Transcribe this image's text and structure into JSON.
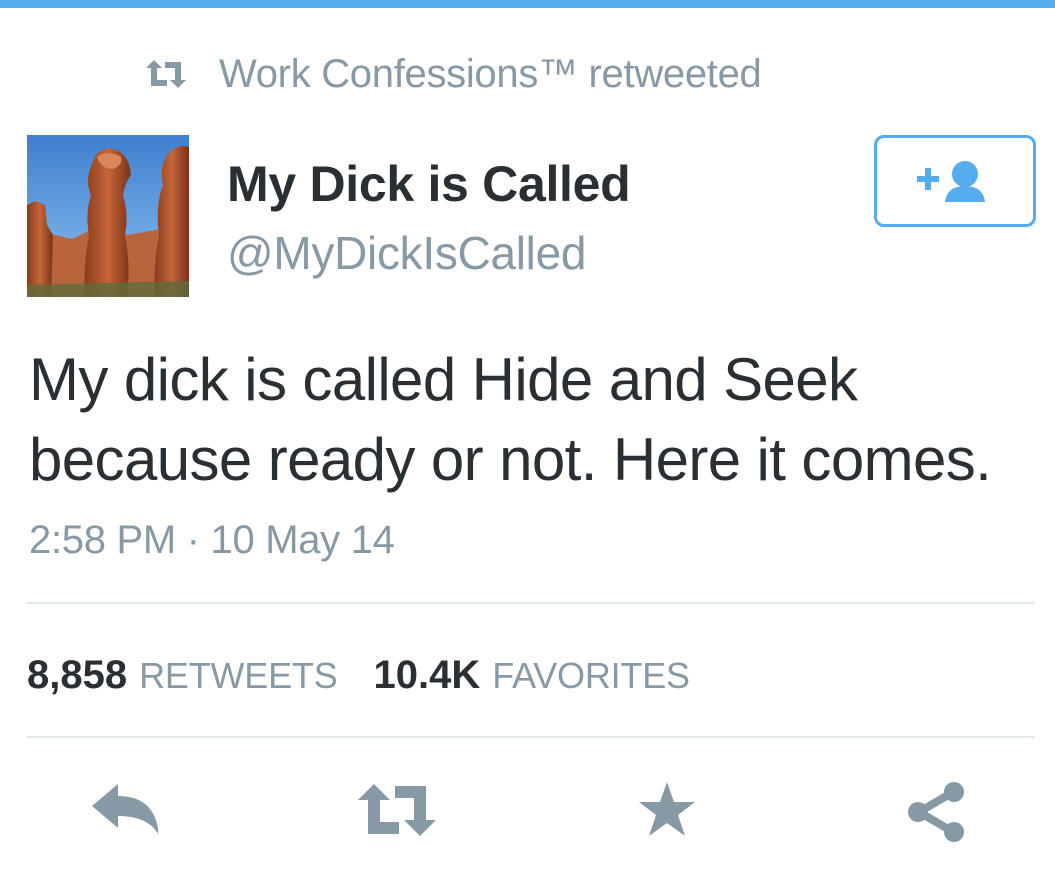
{
  "retweet_context": {
    "text": "Work Confessions™ retweeted",
    "icon": "retweet-icon"
  },
  "author": {
    "name": "My Dick is Called",
    "handle": "@MyDickIsCalled",
    "avatar": "rock-formation-avatar"
  },
  "follow_button": {
    "icon": "follow-user-icon"
  },
  "tweet": {
    "text_line1": "My dick is called Hide and Seek",
    "text_line2": "because ready or not. Here it comes.",
    "timestamp": "2:58 PM · 10 May 14"
  },
  "stats": {
    "retweets_count": "8,858",
    "retweets_label": "RETWEETS",
    "favorites_count": "10.4K",
    "favorites_label": "FAVORITES"
  },
  "actions": [
    {
      "name": "reply",
      "icon": "reply-icon"
    },
    {
      "name": "retweet",
      "icon": "retweet-icon"
    },
    {
      "name": "favorite",
      "icon": "star-icon"
    },
    {
      "name": "share",
      "icon": "share-icon"
    }
  ],
  "colors": {
    "accent": "#55acee",
    "muted": "#8899a6",
    "text": "#292f33",
    "action_icon": "#8899a6",
    "divider": "#e1e8ed"
  }
}
